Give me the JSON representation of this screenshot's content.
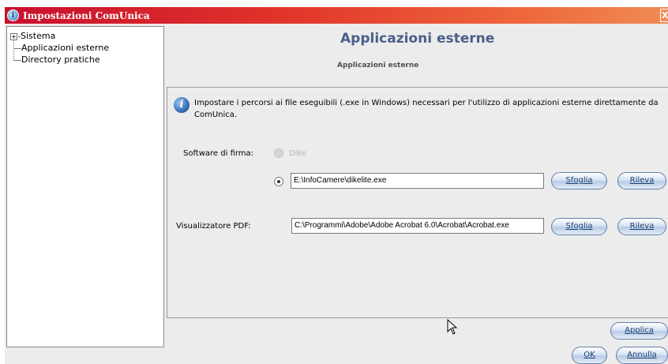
{
  "window": {
    "title": "Impostazioni ComUnica",
    "close_label": "X"
  },
  "tree": {
    "items": [
      {
        "label": "Sistema",
        "expander": "+"
      },
      {
        "label": "Applicazioni esterne"
      },
      {
        "label": "Directory pratiche"
      }
    ]
  },
  "panel": {
    "title": "Applicazioni esterne",
    "subtitle": "Applicazioni esterne"
  },
  "info": {
    "text": "Impostare i percorsi ai file eseguibili (.exe in Windows) necessari per l'utilizzo di applicazioni esterne direttamente da ComUnica."
  },
  "signature": {
    "label": "Software di firma:",
    "option_dike": "Dike",
    "path": "E:\\InfoCamere\\dikelite.exe",
    "browse_label": "Sfoglia",
    "detect_label": "Rileva"
  },
  "pdf_viewer": {
    "label": "Visualizzatore PDF:",
    "path": "C:\\Programmi\\Adobe\\Adobe Acrobat 6.0\\Acrobat\\Acrobat.exe",
    "browse_label": "Sfoglia",
    "detect_label": "Rileva"
  },
  "footer": {
    "apply_label": "Applica",
    "ok_label": "OK",
    "cancel_label": "Annulla"
  }
}
